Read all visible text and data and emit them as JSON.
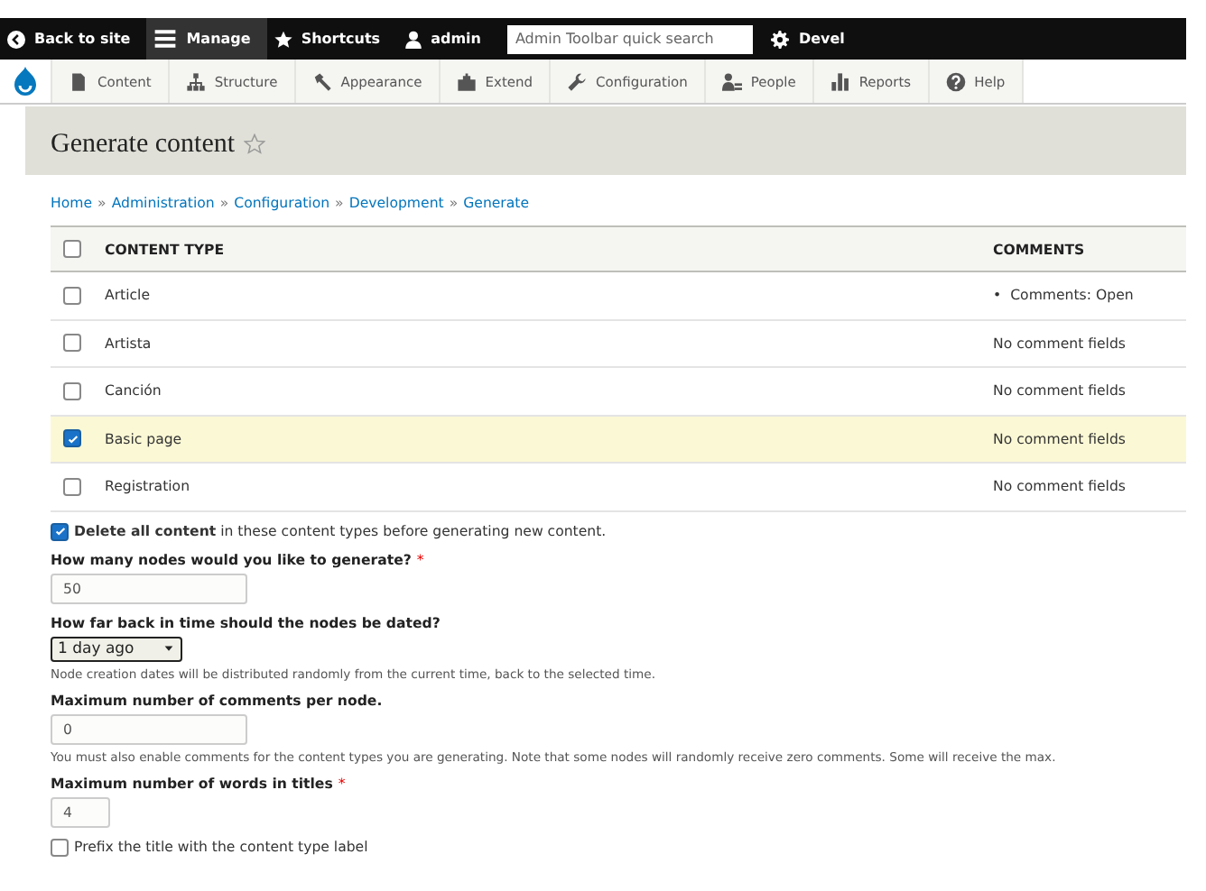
{
  "toolbar": {
    "items": [
      {
        "label": "Back to site",
        "kind": "back",
        "selected": false
      },
      {
        "label": "Manage",
        "kind": "menu",
        "selected": true
      },
      {
        "label": "Shortcuts",
        "kind": "star",
        "selected": false
      },
      {
        "label": "admin",
        "kind": "user",
        "selected": false
      }
    ],
    "search": {
      "placeholder": "Admin Toolbar quick search"
    },
    "devel": {
      "label": "Devel"
    }
  },
  "tray": {
    "items": [
      {
        "label": "Content",
        "kind": "content"
      },
      {
        "label": "Structure",
        "kind": "structure"
      },
      {
        "label": "Appearance",
        "kind": "appearance"
      },
      {
        "label": "Extend",
        "kind": "extend"
      },
      {
        "label": "Configuration",
        "kind": "configuration"
      },
      {
        "label": "People",
        "kind": "people"
      },
      {
        "label": "Reports",
        "kind": "reports"
      },
      {
        "label": "Help",
        "kind": "help"
      }
    ]
  },
  "page_title": "Generate content",
  "breadcrumb": {
    "separator": "»",
    "items": [
      "Home",
      "Administration",
      "Configuration",
      "Development",
      "Generate"
    ]
  },
  "table": {
    "select_all": {
      "checked": false
    },
    "columns": [
      "CONTENT TYPE",
      "COMMENTS"
    ],
    "rows": [
      {
        "checked": false,
        "name": "Article",
        "comments": "Comments: Open",
        "bullet": "•"
      },
      {
        "checked": false,
        "name": "Artista",
        "comments": "No comment fields"
      },
      {
        "checked": false,
        "name": "Canción",
        "comments": "No comment fields"
      },
      {
        "checked": true,
        "name": "Basic page",
        "comments": "No comment fields"
      },
      {
        "checked": false,
        "name": "Registration",
        "comments": "No comment fields"
      }
    ]
  },
  "form": [
    {
      "kind": "checkbox",
      "checked": true,
      "label": "**Delete all content** in these content types before generating new content."
    },
    {
      "kind": "text",
      "label": "How many nodes would you like to generate?",
      "required_mark": "*",
      "value": "50"
    },
    {
      "kind": "select",
      "label": "How far back in time should the nodes be dated?",
      "value": "1 day ago",
      "description": "Node creation dates will be distributed randomly from the current time, back to the selected time."
    },
    {
      "kind": "text",
      "label": "Maximum number of comments per node.",
      "value": "0",
      "description": "You must also enable comments for the content types you are generating. Note that some nodes will randomly receive zero comments. Some will receive the max."
    },
    {
      "kind": "short-text",
      "label": "Maximum number of words in titles",
      "required_mark": "*",
      "value": "4"
    },
    {
      "kind": "checkbox",
      "checked": false,
      "label": "Prefix the title with the content type label"
    }
  ]
}
